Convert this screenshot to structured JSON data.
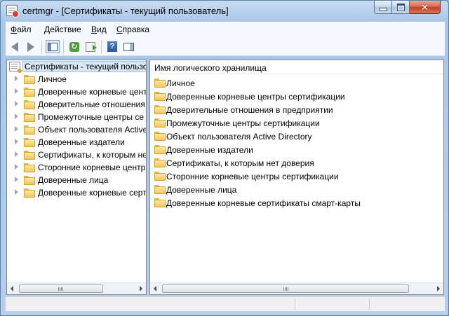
{
  "window": {
    "title": "certmgr - [Сертификаты - текущий пользователь]"
  },
  "menu": [
    {
      "pre": "",
      "key": "Ф",
      "rest": "айл"
    },
    {
      "pre": "",
      "key": "Д",
      "rest": "ействие"
    },
    {
      "pre": "",
      "key": "В",
      "rest": "ид"
    },
    {
      "pre": "",
      "key": "С",
      "rest": "правка"
    }
  ],
  "toolbar": {
    "icons": [
      "back-arrow-icon",
      "forward-arrow-icon",
      "show-hide-tree-icon",
      "refresh-icon",
      "export-list-icon",
      "help-icon",
      "action-pane-icon"
    ]
  },
  "tree": {
    "root_label": "Сертификаты - текущий пользо",
    "items": [
      "Личное",
      "Доверенные корневые цент",
      "Доверительные отношения",
      "Промежуточные центры се",
      "Объект пользователя Active",
      "Доверенные издатели",
      "Сертификаты, к которым не",
      "Сторонние корневые центр",
      "Доверенные лица",
      "Доверенные корневые серт"
    ]
  },
  "list": {
    "column_header": "Имя логического хранилища",
    "items": [
      "Личное",
      "Доверенные корневые центры сертификации",
      "Доверительные отношения в предприятии",
      "Промежуточные центры сертификации",
      "Объект пользователя Active Directory",
      "Доверенные издатели",
      "Сертификаты, к которым нет доверия",
      "Сторонние корневые центры сертификации",
      "Доверенные лица",
      "Доверенные корневые сертификаты смарт-карты"
    ]
  },
  "caption_buttons": {
    "close_glyph": "✕"
  }
}
